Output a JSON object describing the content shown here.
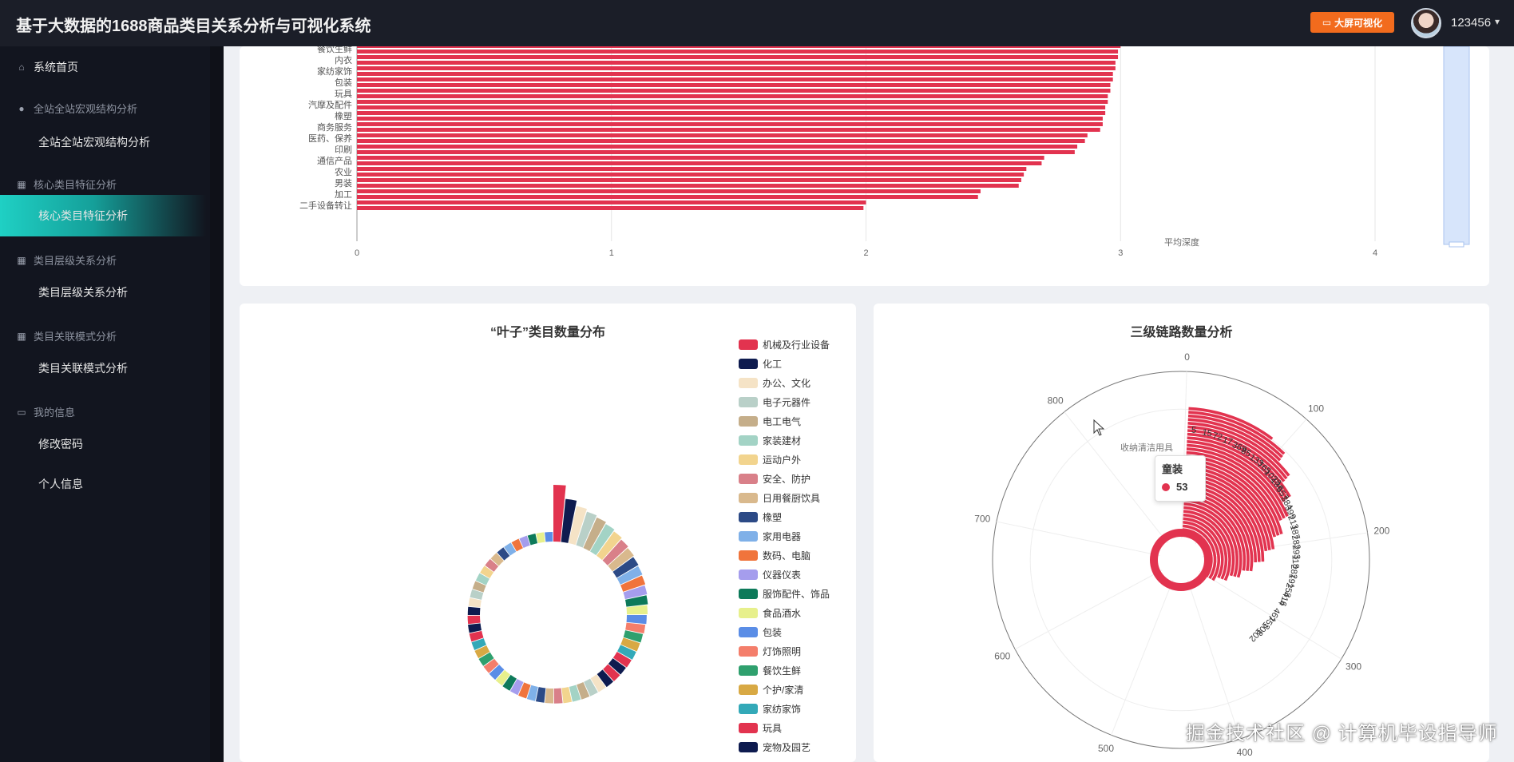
{
  "header": {
    "title": "基于大数据的1688商品类目关系分析与可视化系统",
    "bigscreen_label": "大屏可视化",
    "username": "123456"
  },
  "sidebar": {
    "home": "系统首页",
    "groups": [
      {
        "group": "全站全站宏观结构分析",
        "item": "全站全站宏观结构分析"
      },
      {
        "group": "核心类目特征分析",
        "item": "核心类目特征分析"
      },
      {
        "group": "类目层级关系分析",
        "item": "类目层级关系分析"
      },
      {
        "group": "类目关联模式分析",
        "item": "类目关联模式分析"
      }
    ],
    "account_group": "我的信息",
    "account_items": [
      "修改密码",
      "个人信息"
    ]
  },
  "colors": {
    "accent": "#1fd0c4",
    "bar": "#e2334f",
    "topbar": "#1b1e28",
    "sidebar": "#12151f",
    "button": "#f26b1d"
  },
  "chart_data": [
    {
      "type": "bar",
      "orientation": "horizontal",
      "categories": [
        "餐饮生鲜",
        "内衣",
        "家纺家饰",
        "包装",
        "玩具",
        "汽摩及配件",
        "橡塑",
        "商务服务",
        "医药、保养",
        "印刷",
        "通信产品",
        "农业",
        "男装",
        "加工",
        "二手设备转让"
      ],
      "values": [
        3.0,
        2.99,
        2.98,
        2.97,
        2.96,
        2.95,
        2.94,
        2.93,
        2.87,
        2.83,
        2.7,
        2.63,
        2.61,
        2.45,
        2.0
      ],
      "xticks": [
        "0",
        "1",
        "2",
        "3",
        "4"
      ],
      "xlim": [
        0,
        4
      ],
      "legend": "平均深度"
    },
    {
      "type": "pie",
      "subtype": "rose",
      "title": "“叶子”类目数量分布",
      "legend": [
        "机械及行业设备",
        "化工",
        "办公、文化",
        "电子元器件",
        "电工电气",
        "家装建材",
        "运动户外",
        "安全、防护",
        "日用餐厨饮具",
        "橡塑",
        "家用电器",
        "数码、电脑",
        "仪器仪表",
        "服饰配件、饰品",
        "食品酒水",
        "包装",
        "灯饰照明",
        "餐饮生鲜",
        "个护/家清",
        "家纺家饰",
        "玩具",
        "宠物及园艺"
      ],
      "values": [
        1120,
        820,
        700,
        640,
        600,
        560,
        520,
        480,
        450,
        420,
        400,
        380,
        360,
        340,
        320,
        300,
        280,
        260,
        250,
        240,
        230,
        220
      ],
      "colors": [
        "#e2334f",
        "#0e1b4f",
        "#f5e3c6",
        "#b9d0c8",
        "#c5ae8a",
        "#a3d3c5",
        "#f2d48e",
        "#d98089",
        "#d9b98d",
        "#2c4a86",
        "#7fb0e8",
        "#f0743c",
        "#a59ded",
        "#0d7a5a",
        "#e7f08c",
        "#5a8de6",
        "#f47e6b",
        "#2fa06e",
        "#d8a944",
        "#33a9b8",
        "#e2334f",
        "#0e1b4f"
      ]
    },
    {
      "type": "bar",
      "subtype": "polar",
      "title": "三级链路数量分析",
      "angle_ticks": [
        "0",
        "100",
        "200",
        "300",
        "400",
        "500",
        "600",
        "700",
        "800"
      ],
      "angle_max": 900,
      "highlight_label": "收纳清洁用具",
      "bar_labels": [
        "5",
        "15",
        "72",
        "17",
        "369",
        "85",
        "133",
        "765",
        "1028",
        "136",
        "557",
        "384",
        "399",
        "213",
        "187",
        "282",
        "293",
        "118",
        "282",
        "191",
        "258",
        "416",
        "4",
        "461",
        "753",
        "108",
        "102"
      ],
      "tooltip": {
        "name": "童装",
        "value": "53"
      }
    }
  ],
  "watermark": "掘金技术社区 @ 计算机毕设指导师"
}
